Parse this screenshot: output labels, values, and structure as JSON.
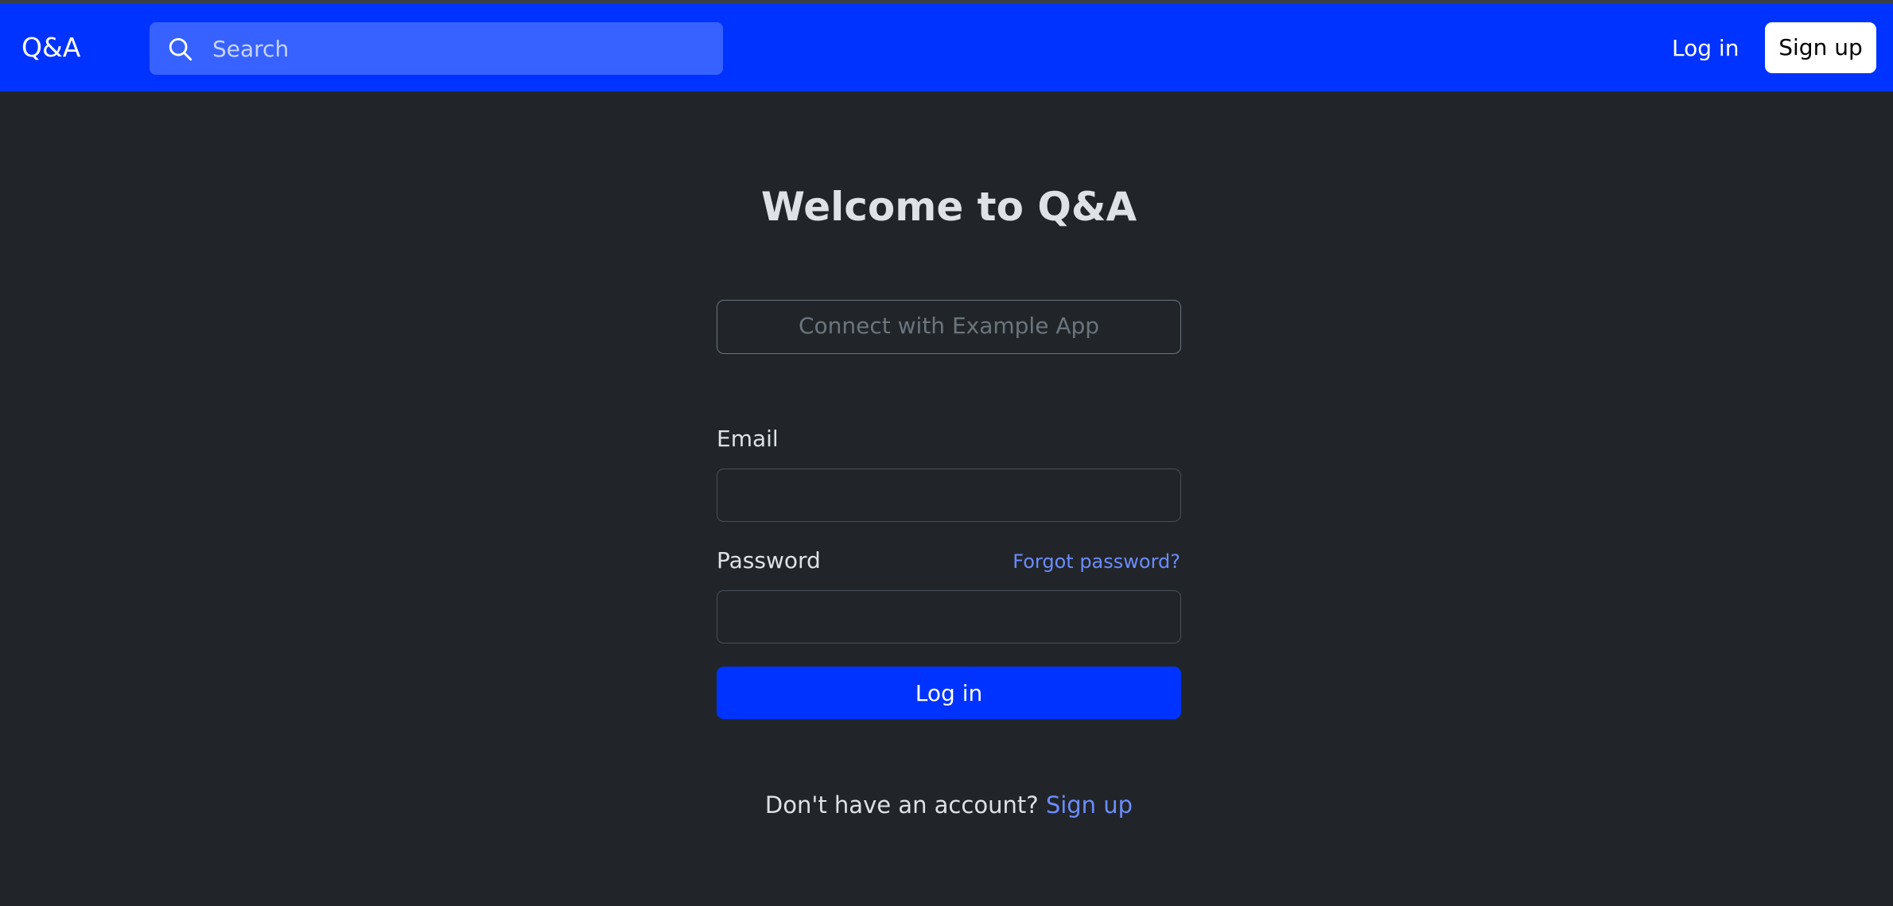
{
  "header": {
    "brand": "Q&A",
    "search_placeholder": "Search",
    "login_label": "Log in",
    "signup_label": "Sign up"
  },
  "main": {
    "title": "Welcome to Q&A",
    "connect_label": "Connect with Example App",
    "email_label": "Email",
    "email_value": "",
    "password_label": "Password",
    "password_value": "",
    "forgot_label": "Forgot password?",
    "login_button": "Log in",
    "no_account_text": "Don't have an account?",
    "signup_link": "Sign up"
  },
  "icons": {
    "search": "search-icon"
  },
  "colors": {
    "navbar": "#0033ff",
    "search_bg": "#3762ff",
    "page_bg": "#212529",
    "link": "#6c8cff",
    "primary_button": "#0033ff"
  }
}
